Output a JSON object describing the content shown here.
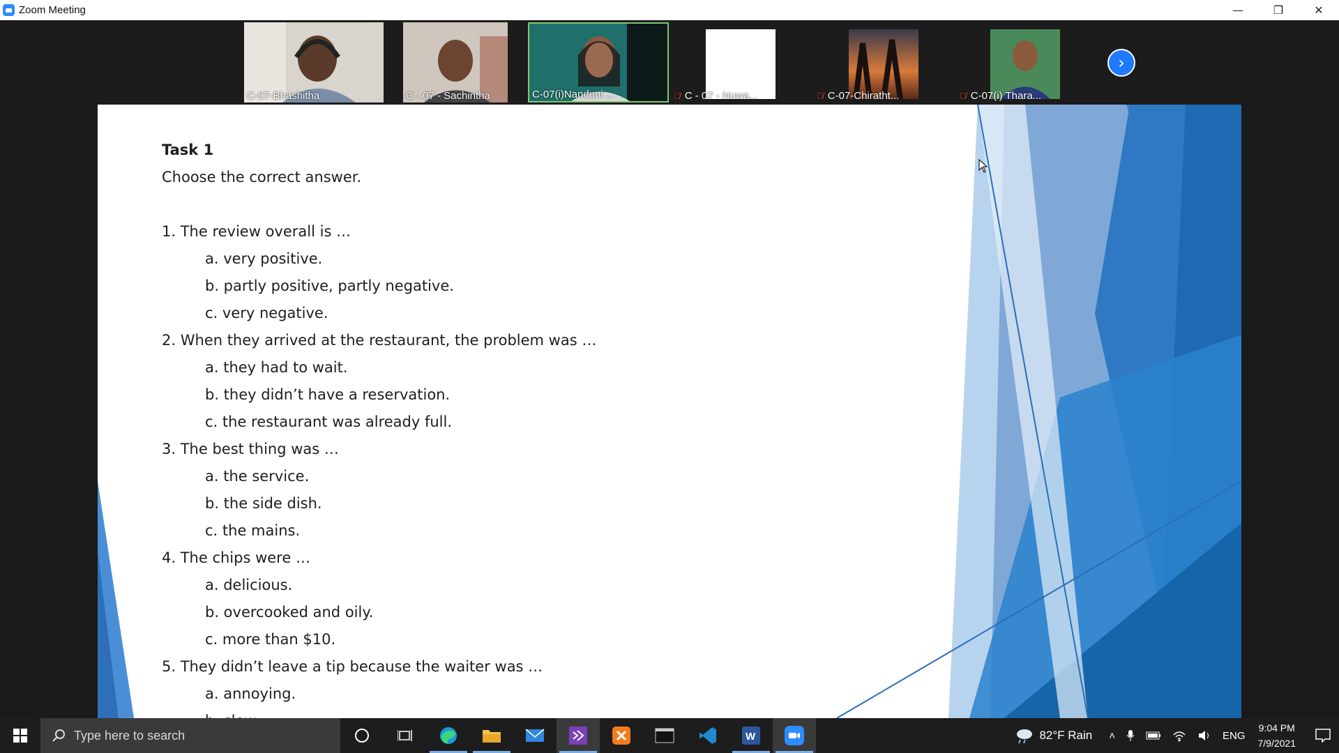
{
  "window": {
    "title": "Zoom Meeting",
    "minimize": "—",
    "restore": "❐",
    "close": "✕"
  },
  "participants": [
    {
      "name": "C-07-Bhashitha",
      "muted": false,
      "active": false
    },
    {
      "name": "C - 07 - Sachintha",
      "muted": false,
      "active": false
    },
    {
      "name": "C-07(i)Nanduni ...",
      "muted": false,
      "active": true
    },
    {
      "name": "C - 07 - Nuwa...",
      "muted": true,
      "active": false
    },
    {
      "name": "C-07-Chiratht...",
      "muted": true,
      "active": false
    },
    {
      "name": "C-07(i) Thara...",
      "muted": true,
      "active": false
    }
  ],
  "gallery": {
    "next_icon": "chevron-right-icon",
    "next_glyph": "›"
  },
  "slide": {
    "title": "Task 1",
    "instruction": "Choose the correct answer.",
    "questions": [
      {
        "text": "1. The review overall is …",
        "options": [
          "a. very positive.",
          "b. partly positive, partly negative.",
          "c. very negative."
        ]
      },
      {
        "text": "2. When they arrived at the restaurant, the problem was …",
        "options": [
          "a. they had to wait.",
          "b. they didn’t have a reservation.",
          "c. the restaurant was already full."
        ]
      },
      {
        "text": "3. The best thing was …",
        "options": [
          "a. the service.",
          "b. the side dish.",
          "c. the mains."
        ]
      },
      {
        "text": "4. The chips were …",
        "options": [
          "a. delicious.",
          "b. overcooked and oily.",
          "c. more than $10."
        ]
      },
      {
        "text": "5. They didn’t leave a tip because the waiter was …",
        "options": [
          "a. annoying.",
          "b. slow."
        ]
      }
    ]
  },
  "taskbar": {
    "search_placeholder": "Type here to search",
    "weather": "82°F  Rain",
    "language": "ENG",
    "time": "9:04 PM",
    "date": "7/9/2021"
  },
  "colors": {
    "zoom_blue": "#2d8cff",
    "active_speaker": "#7dc96b",
    "muted": "#e03b3b"
  }
}
